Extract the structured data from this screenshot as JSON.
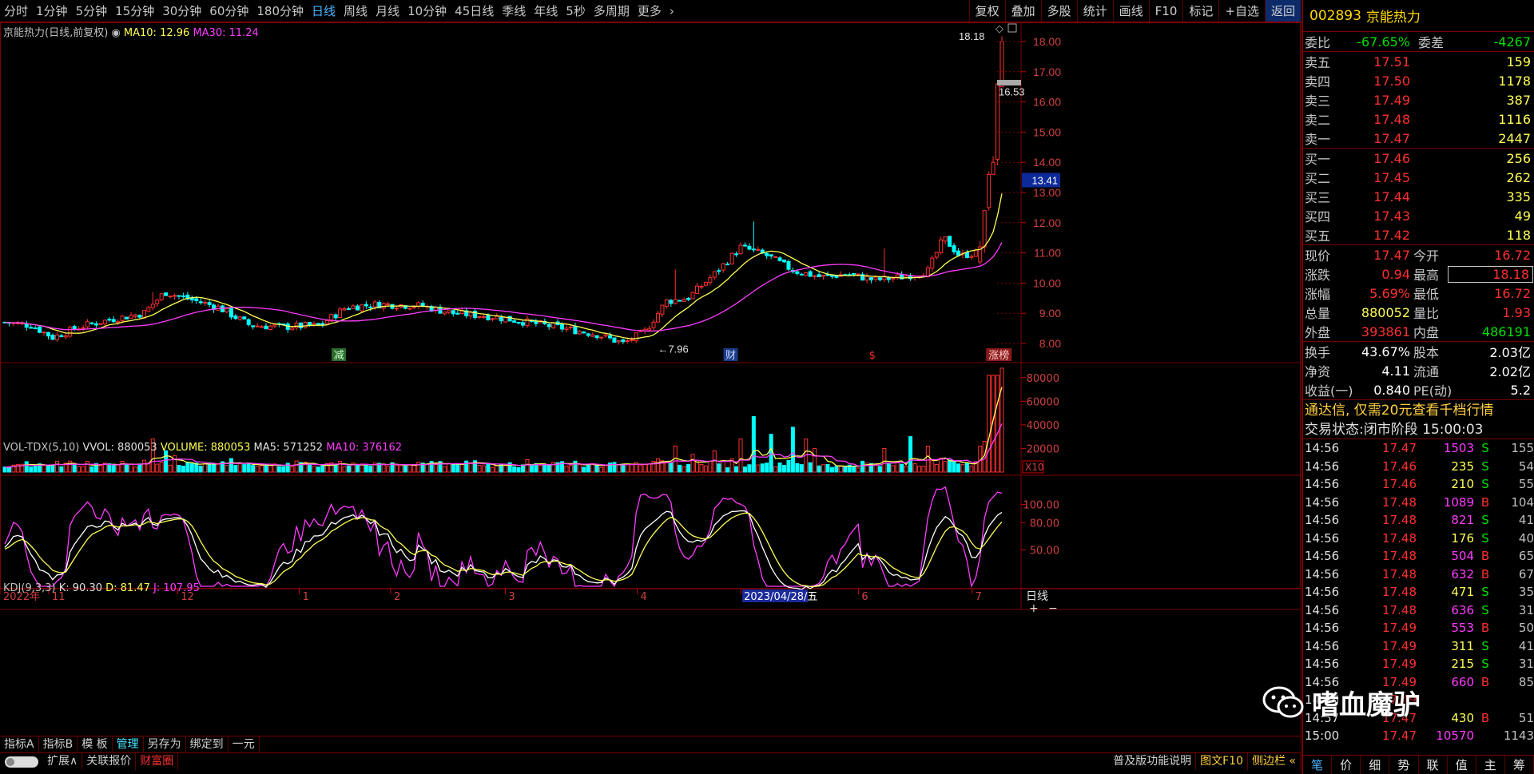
{
  "period_bar": {
    "items": [
      "分时",
      "1分钟",
      "5分钟",
      "15分钟",
      "30分钟",
      "60分钟",
      "180分钟",
      "日线",
      "周线",
      "月线",
      "10分钟",
      "45日线",
      "季线",
      "年线",
      "5秒",
      "多周期",
      "更多"
    ],
    "active": "日线",
    "chevron": "›"
  },
  "tools": [
    "复权",
    "叠加",
    "多股",
    "统计",
    "画线",
    "F10",
    "标记",
    "+自选",
    "返回"
  ],
  "legends": {
    "price_title": "京能热力(日线,前复权)",
    "ma10": "MA10: 12.96",
    "ma30": "MA30: 11.24",
    "vol_title": "VOL-TDX(5,10)",
    "vvol": "VVOL: 880053",
    "volume": "VOLUME: 880053",
    "ma5": "MA5: 571252",
    "ma10v": "MA10: 376162",
    "kdj_title": "KDJ(9,3,3)",
    "k": "K: 90.30",
    "d": "D: 81.47",
    "j": "J: 107.95"
  },
  "price_axis": [
    "18.00",
    "17.00",
    "16.00",
    "15.00",
    "14.00",
    "13.00",
    "12.00",
    "11.00",
    "10.00",
    "9.00",
    "8.00"
  ],
  "price_axis_values": [
    18,
    17,
    16,
    15,
    14,
    13,
    12,
    11,
    10,
    9,
    8
  ],
  "price_current_tag": "13.41",
  "price_cursor_tag": "16.53",
  "price_high_label": "18.18",
  "price_low_label": "7.96",
  "event_marks": [
    "减",
    "财",
    "$",
    "涨榜"
  ],
  "vol_axis": [
    "80000",
    "60000",
    "40000",
    "20000"
  ],
  "vol_axis_values": [
    80000,
    60000,
    40000,
    20000
  ],
  "vol_unit": "X10",
  "kdj_axis": [
    "100.00",
    "80.00",
    "50.00"
  ],
  "kdj_axis_values": [
    100,
    80,
    50
  ],
  "date_axis": {
    "labels": [
      "2022年",
      "11",
      "12",
      "1",
      "2",
      "3",
      "4",
      "2023/04/28/五",
      "6",
      "7"
    ],
    "period": "日线",
    "zoom_plus": "+",
    "zoom_minus": "−"
  },
  "bottom_tabs_1": [
    "指标A",
    "指标B",
    "模 板",
    "管理",
    "另存为",
    "绑定到",
    "一元"
  ],
  "bottom_tabs_2": [
    "扩展∧",
    "关联报价",
    "财富圈"
  ],
  "bottom_right_1": [
    "普及版功能说明",
    "图文F10",
    "侧边栏 «"
  ],
  "stock": {
    "code": "002893",
    "name": "京能热力"
  },
  "order_book": {
    "weibi_label": "委比",
    "weibi": "-67.65%",
    "weicha_label": "委差",
    "weicha": "-4267",
    "asks": [
      {
        "label": "卖五",
        "price": "17.51",
        "vol": "159"
      },
      {
        "label": "卖四",
        "price": "17.50",
        "vol": "1178"
      },
      {
        "label": "卖三",
        "price": "17.49",
        "vol": "387"
      },
      {
        "label": "卖二",
        "price": "17.48",
        "vol": "1116"
      },
      {
        "label": "卖一",
        "price": "17.47",
        "vol": "2447"
      }
    ],
    "bids": [
      {
        "label": "买一",
        "price": "17.46",
        "vol": "256"
      },
      {
        "label": "买二",
        "price": "17.45",
        "vol": "262"
      },
      {
        "label": "买三",
        "price": "17.44",
        "vol": "335"
      },
      {
        "label": "买四",
        "price": "17.43",
        "vol": "49"
      },
      {
        "label": "买五",
        "price": "17.42",
        "vol": "118"
      }
    ]
  },
  "quote": [
    {
      "l1": "现价",
      "v1": "17.47",
      "c1": "red",
      "l2": "今开",
      "v2": "16.72",
      "c2": "red"
    },
    {
      "l1": "涨跌",
      "v1": "0.94",
      "c1": "red",
      "l2": "最高",
      "v2": "18.18",
      "c2": "red"
    },
    {
      "l1": "涨幅",
      "v1": "5.69%",
      "c1": "red",
      "l2": "最低",
      "v2": "16.72",
      "c2": "red"
    },
    {
      "l1": "总量",
      "v1": "880052",
      "c1": "yellow",
      "l2": "量比",
      "v2": "1.93",
      "c2": "red"
    },
    {
      "l1": "外盘",
      "v1": "393861",
      "c1": "red",
      "l2": "内盘",
      "v2": "486191",
      "c2": "green"
    }
  ],
  "fundamentals": [
    {
      "l1": "换手",
      "v1": "43.67%",
      "l2": "股本",
      "v2": "2.03亿"
    },
    {
      "l1": "净资",
      "v1": "4.11",
      "l2": "流通",
      "v2": "2.02亿"
    },
    {
      "l1": "收益(一)",
      "v1": "0.840",
      "l2": "PE(动)",
      "v2": "5.2"
    }
  ],
  "ad_text": "通达信, 仅需20元查看千档行情",
  "status_text": "交易状态:闭市阶段 15:00:03",
  "ticks": [
    {
      "t": "14:56",
      "p": "17.47",
      "v": "1503",
      "vc": "magenta",
      "s": "S",
      "n": "155"
    },
    {
      "t": "14:56",
      "p": "17.46",
      "v": "235",
      "vc": "yellow",
      "s": "S",
      "n": "54"
    },
    {
      "t": "14:56",
      "p": "17.46",
      "v": "210",
      "vc": "yellow",
      "s": "S",
      "n": "55"
    },
    {
      "t": "14:56",
      "p": "17.48",
      "v": "1089",
      "vc": "magenta",
      "s": "B",
      "n": "104"
    },
    {
      "t": "14:56",
      "p": "17.48",
      "v": "821",
      "vc": "magenta",
      "s": "S",
      "n": "41"
    },
    {
      "t": "14:56",
      "p": "17.48",
      "v": "176",
      "vc": "yellow",
      "s": "S",
      "n": "40"
    },
    {
      "t": "14:56",
      "p": "17.48",
      "v": "504",
      "vc": "magenta",
      "s": "B",
      "n": "65"
    },
    {
      "t": "14:56",
      "p": "17.48",
      "v": "632",
      "vc": "magenta",
      "s": "B",
      "n": "67"
    },
    {
      "t": "14:56",
      "p": "17.48",
      "v": "471",
      "vc": "yellow",
      "s": "S",
      "n": "35"
    },
    {
      "t": "14:56",
      "p": "17.48",
      "v": "636",
      "vc": "magenta",
      "s": "S",
      "n": "31"
    },
    {
      "t": "14:56",
      "p": "17.49",
      "v": "553",
      "vc": "magenta",
      "s": "B",
      "n": "50"
    },
    {
      "t": "14:56",
      "p": "17.49",
      "v": "311",
      "vc": "yellow",
      "s": "S",
      "n": "41"
    },
    {
      "t": "14:56",
      "p": "17.49",
      "v": "215",
      "vc": "yellow",
      "s": "S",
      "n": "31"
    },
    {
      "t": "14:56",
      "p": "17.49",
      "v": "660",
      "vc": "magenta",
      "s": "B",
      "n": "85"
    },
    {
      "t": "14:56",
      "p": "17.49",
      "v": "",
      "vc": "yellow",
      "s": "",
      "n": ""
    },
    {
      "t": "14:57",
      "p": "17.47",
      "v": "430",
      "vc": "yellow",
      "s": "B",
      "n": "51"
    },
    {
      "t": "15:00",
      "p": "17.47",
      "v": "10570",
      "vc": "magenta",
      "s": "",
      "n": "1143"
    }
  ],
  "right_tabs": [
    "笔",
    "价",
    "细",
    "势",
    "联",
    "值",
    "主",
    "筹"
  ],
  "watermark": "嗜血魔驴",
  "colors": {
    "up": "#ff3030",
    "down": "#00ffff",
    "ma_short": "#ffff54",
    "ma_long": "#ff3bff",
    "k_line": "#ffffff",
    "d_line": "#ffff54",
    "j_line": "#ff3bff",
    "frame": "#7a0000"
  }
}
